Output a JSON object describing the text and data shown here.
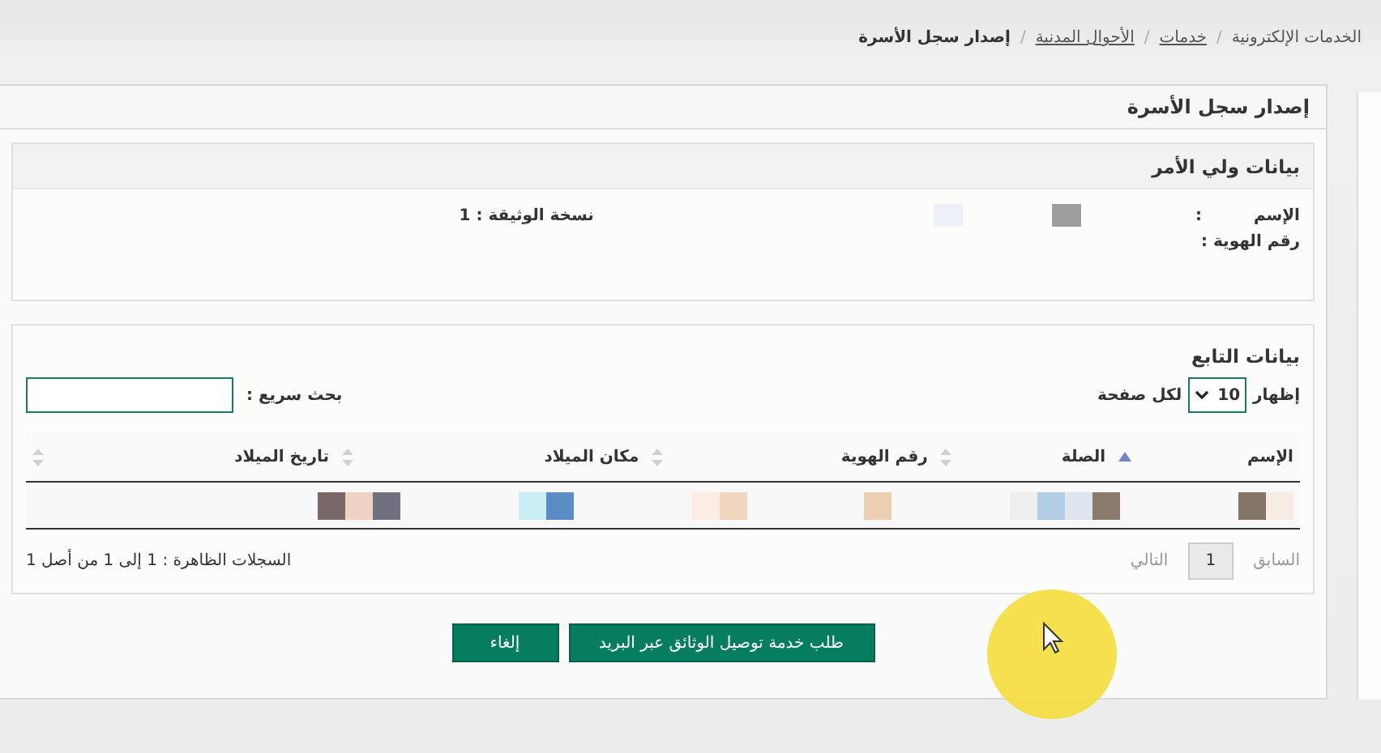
{
  "breadcrumb": [
    {
      "label": "الخدمات الإلكترونية",
      "kind": "text"
    },
    {
      "label": "خدمات",
      "kind": "link"
    },
    {
      "label": "الأحوال المدنية",
      "kind": "link"
    },
    {
      "label": "إصدار سجل الأسرة",
      "kind": "current"
    }
  ],
  "breadcrumb_separator": "/",
  "panel_title": "إصدار سجل الأسرة",
  "guardian": {
    "title": "بيانات ولي الأمر",
    "name_label": "الإسم",
    "colon": ":",
    "id_label": "رقم الهوية :",
    "copy_label": "نسخة الوثيقة : 1"
  },
  "dependents": {
    "title": "بيانات التابع",
    "show_label": "إظهار",
    "page_size": "10",
    "per_page_label": "لكل صفحة",
    "search_label": "بحث سريع :",
    "columns": [
      {
        "label": "الإسم",
        "sorted": true
      },
      {
        "label": "الصلة",
        "sorted": false
      },
      {
        "label": "رقم الهوية",
        "sorted": false
      },
      {
        "label": "مكان الميلاد",
        "sorted": false
      },
      {
        "label": "تاريخ الميلاد",
        "sorted": false
      }
    ],
    "info": "السجلات الظاهرة : 1 إلى 1 من أصل 1",
    "pager": [
      {
        "label": "السابق",
        "kind": "prev",
        "disabled": true
      },
      {
        "label": "1",
        "kind": "page",
        "selected": true
      },
      {
        "label": "التالي",
        "kind": "next",
        "disabled": true
      }
    ]
  },
  "buttons": [
    "طلب خدمة توصيل الوثائق عبر البريد",
    "إلغاء"
  ]
}
